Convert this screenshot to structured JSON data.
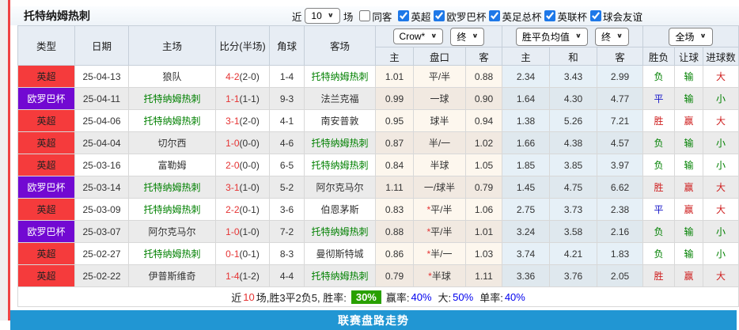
{
  "header": {
    "team_title": "托特纳姆热刺",
    "near_label": "近",
    "matches_count": "10",
    "matches_unit": "场",
    "same_away": {
      "label": "同客",
      "checked": false
    },
    "filters": [
      {
        "label": "英超",
        "checked": true
      },
      {
        "label": "欧罗巴杯",
        "checked": true
      },
      {
        "label": "英足总杯",
        "checked": true
      },
      {
        "label": "英联杯",
        "checked": true
      },
      {
        "label": "球会友谊",
        "checked": true
      }
    ]
  },
  "controls": {
    "odds_company": "Crow*",
    "odds_state": "终",
    "avg_type": "胜平负均值",
    "avg_state": "终",
    "scope": "全场"
  },
  "columns": {
    "type": "类型",
    "date": "日期",
    "home": "主场",
    "score": "比分(半场)",
    "corner": "角球",
    "away": "客场",
    "odds_home": "主",
    "handicap": "盘口",
    "odds_away": "客",
    "avg_home": "主",
    "avg_draw": "和",
    "avg_away": "客",
    "result_wdl": "胜负",
    "result_handicap": "让球",
    "result_goals": "进球数"
  },
  "rows": [
    {
      "league": "英超",
      "league_color": "red",
      "date": "25-04-13",
      "home": "狼队",
      "home_color": "dark",
      "score": "4-2",
      "half": "(2-0)",
      "corner": "1-4",
      "away": "托特纳姆热刺",
      "away_color": "green",
      "odds_home": "1.01",
      "star": "",
      "handicap": "平/半",
      "odds_away": "0.88",
      "avg_home": "2.34",
      "avg_draw": "3.43",
      "avg_away": "2.99",
      "wdl": "负",
      "wdl_color": "green",
      "give": "输",
      "give_color": "green",
      "goals": "大",
      "goals_color": "red"
    },
    {
      "league": "欧罗巴杯",
      "league_color": "purple",
      "date": "25-04-11",
      "home": "托特纳姆热刺",
      "home_color": "green",
      "score": "1-1",
      "half": "(1-1)",
      "corner": "9-3",
      "away": "法兰克福",
      "away_color": "dark",
      "odds_home": "0.99",
      "star": "",
      "handicap": "一球",
      "odds_away": "0.90",
      "avg_home": "1.64",
      "avg_draw": "4.30",
      "avg_away": "4.77",
      "wdl": "平",
      "wdl_color": "blue",
      "give": "输",
      "give_color": "green",
      "goals": "小",
      "goals_color": "green"
    },
    {
      "league": "英超",
      "league_color": "red",
      "date": "25-04-06",
      "home": "托特纳姆热刺",
      "home_color": "green",
      "score": "3-1",
      "half": "(2-0)",
      "corner": "4-1",
      "away": "南安普敦",
      "away_color": "dark",
      "odds_home": "0.95",
      "star": "",
      "handicap": "球半",
      "odds_away": "0.94",
      "avg_home": "1.38",
      "avg_draw": "5.26",
      "avg_away": "7.21",
      "wdl": "胜",
      "wdl_color": "red",
      "give": "赢",
      "give_color": "red",
      "goals": "大",
      "goals_color": "red"
    },
    {
      "league": "英超",
      "league_color": "red",
      "date": "25-04-04",
      "home": "切尔西",
      "home_color": "dark",
      "score": "1-0",
      "half": "(0-0)",
      "corner": "4-6",
      "away": "托特纳姆热刺",
      "away_color": "green",
      "odds_home": "0.87",
      "star": "",
      "handicap": "半/一",
      "odds_away": "1.02",
      "avg_home": "1.66",
      "avg_draw": "4.38",
      "avg_away": "4.57",
      "wdl": "负",
      "wdl_color": "green",
      "give": "输",
      "give_color": "green",
      "goals": "小",
      "goals_color": "green"
    },
    {
      "league": "英超",
      "league_color": "red",
      "date": "25-03-16",
      "home": "富勒姆",
      "home_color": "dark",
      "score": "2-0",
      "half": "(0-0)",
      "corner": "6-5",
      "away": "托特纳姆热刺",
      "away_color": "green",
      "odds_home": "0.84",
      "star": "",
      "handicap": "半球",
      "odds_away": "1.05",
      "avg_home": "1.85",
      "avg_draw": "3.85",
      "avg_away": "3.97",
      "wdl": "负",
      "wdl_color": "green",
      "give": "输",
      "give_color": "green",
      "goals": "小",
      "goals_color": "green"
    },
    {
      "league": "欧罗巴杯",
      "league_color": "purple",
      "date": "25-03-14",
      "home": "托特纳姆热刺",
      "home_color": "green",
      "score": "3-1",
      "half": "(1-0)",
      "corner": "5-2",
      "away": "阿尔克马尔",
      "away_color": "dark",
      "odds_home": "1.11",
      "star": "",
      "handicap": "一/球半",
      "odds_away": "0.79",
      "avg_home": "1.45",
      "avg_draw": "4.75",
      "avg_away": "6.62",
      "wdl": "胜",
      "wdl_color": "red",
      "give": "赢",
      "give_color": "red",
      "goals": "大",
      "goals_color": "red"
    },
    {
      "league": "英超",
      "league_color": "red",
      "date": "25-03-09",
      "home": "托特纳姆热刺",
      "home_color": "green",
      "score": "2-2",
      "half": "(0-1)",
      "corner": "3-6",
      "away": "伯恩茅斯",
      "away_color": "dark",
      "odds_home": "0.83",
      "star": "*",
      "handicap": "平/半",
      "odds_away": "1.06",
      "avg_home": "2.75",
      "avg_draw": "3.73",
      "avg_away": "2.38",
      "wdl": "平",
      "wdl_color": "blue",
      "give": "赢",
      "give_color": "red",
      "goals": "大",
      "goals_color": "red"
    },
    {
      "league": "欧罗巴杯",
      "league_color": "purple",
      "date": "25-03-07",
      "home": "阿尔克马尔",
      "home_color": "dark",
      "score": "1-0",
      "half": "(1-0)",
      "corner": "7-2",
      "away": "托特纳姆热刺",
      "away_color": "green",
      "odds_home": "0.88",
      "star": "*",
      "handicap": "平/半",
      "odds_away": "1.01",
      "avg_home": "3.24",
      "avg_draw": "3.58",
      "avg_away": "2.16",
      "wdl": "负",
      "wdl_color": "green",
      "give": "输",
      "give_color": "green",
      "goals": "小",
      "goals_color": "green"
    },
    {
      "league": "英超",
      "league_color": "red",
      "date": "25-02-27",
      "home": "托特纳姆热刺",
      "home_color": "green",
      "score": "0-1",
      "half": "(0-1)",
      "corner": "8-3",
      "away": "曼彻斯特城",
      "away_color": "dark",
      "odds_home": "0.86",
      "star": "*",
      "handicap": "半/一",
      "odds_away": "1.03",
      "avg_home": "3.74",
      "avg_draw": "4.21",
      "avg_away": "1.83",
      "wdl": "负",
      "wdl_color": "green",
      "give": "输",
      "give_color": "green",
      "goals": "小",
      "goals_color": "green"
    },
    {
      "league": "英超",
      "league_color": "red",
      "date": "25-02-22",
      "home": "伊普斯维奇",
      "home_color": "dark",
      "score": "1-4",
      "half": "(1-2)",
      "corner": "4-4",
      "away": "托特纳姆热刺",
      "away_color": "green",
      "odds_home": "0.79",
      "star": "*",
      "handicap": "半球",
      "odds_away": "1.11",
      "avg_home": "3.36",
      "avg_draw": "3.76",
      "avg_away": "2.05",
      "wdl": "胜",
      "wdl_color": "red",
      "give": "赢",
      "give_color": "red",
      "goals": "大",
      "goals_color": "red"
    }
  ],
  "summary": {
    "near_label": "近",
    "count": "10",
    "text": "场,胜3平2负5, 胜率:",
    "win_rate": "30%",
    "win_odds_label": "赢率:",
    "win_odds": "40%",
    "big_label": "大:",
    "big": "50%",
    "single_label": "单率:",
    "single": "40%"
  },
  "footer": {
    "title": "联赛盘路走势"
  },
  "colors": {
    "league_red": "#f53b3c",
    "league_purple": "#7209d2",
    "team_green": "#008000",
    "score_red": "#e53333",
    "result_red": "#cf2020",
    "result_green": "#008000",
    "result_blue": "#1515c8",
    "badge_green": "#28a000",
    "footer_blue": "#2196d3",
    "left_strip_red": "#ef4545"
  }
}
